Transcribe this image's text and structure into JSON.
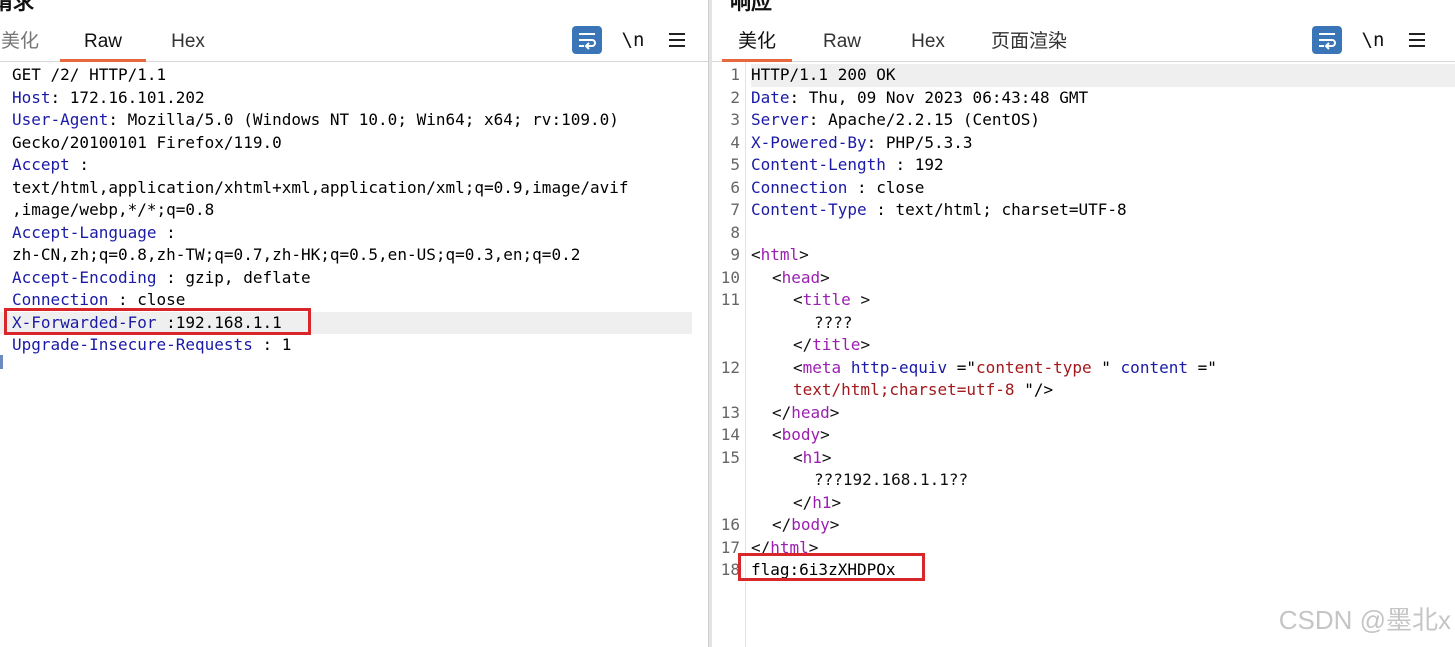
{
  "request": {
    "title": "请求",
    "tabs": [
      {
        "label": "美化",
        "active": false
      },
      {
        "label": "Raw",
        "active": true
      },
      {
        "label": "Hex",
        "active": false
      }
    ],
    "tools": {
      "newline_label": "\\n"
    },
    "lines": [
      {
        "plain": "GET /2/ HTTP/1.1"
      },
      {
        "key": "Host",
        "sep": ": ",
        "value": "172.16.101.202"
      },
      {
        "key": "User-Agent",
        "sep": ": ",
        "value": "Mozilla/5.0 (Windows NT 10.0; Win64; x64; rv:109.0)"
      },
      {
        "plain": "Gecko/20100101 Firefox/119.0"
      },
      {
        "key": "Accept",
        "sep": " :",
        "value": ""
      },
      {
        "plain": "text/html,application/xhtml+xml,application/xml;q=0.9,image/avif"
      },
      {
        "plain": ",image/webp,*/*;q=0.8"
      },
      {
        "key": "Accept-Language",
        "sep": " :",
        "value": ""
      },
      {
        "plain": "zh-CN,zh;q=0.8,zh-TW;q=0.7,zh-HK;q=0.5,en-US;q=0.3,en;q=0.2"
      },
      {
        "key": "Accept-Encoding",
        "sep": " : ",
        "value": "gzip, deflate"
      },
      {
        "key": "Connection",
        "sep": " : ",
        "value": "close"
      },
      {
        "key": "X-Forwarded-For",
        "sep": " :",
        "value": "192.168.1.1",
        "highlight": true
      },
      {
        "key": "Upgrade-Insecure-Requests",
        "sep": " : ",
        "value": "1"
      }
    ]
  },
  "response": {
    "title": "响应",
    "tabs": [
      {
        "label": "美化",
        "active": true
      },
      {
        "label": "Raw",
        "active": false
      },
      {
        "label": "Hex",
        "active": false
      },
      {
        "label": "页面渲染",
        "active": false
      }
    ],
    "tools": {
      "newline_label": "\\n"
    },
    "line_numbers": [
      "1",
      "2",
      "3",
      "4",
      "5",
      "6",
      "7",
      "8",
      "9",
      "10",
      "11",
      "",
      "",
      "12",
      "",
      "13",
      "14",
      "15",
      "",
      "",
      "16",
      "17",
      "18"
    ],
    "header_lines": {
      "status": "HTTP/1.1 200 OK",
      "date_key": "Date",
      "date_val": ": Thu, 09 Nov 2023 06:43:48 GMT",
      "server_key": "Server",
      "server_val": ": Apache/2.2.15 (CentOS)",
      "powered_key": "X-Powered-By",
      "powered_val": ": PHP/5.3.3",
      "length_key": "Content-Length",
      "length_val": " : 192",
      "conn_key": "Connection",
      "conn_val": " : close",
      "type_key": "Content-Type",
      "type_val": " : text/html; charset=UTF-8"
    },
    "html": {
      "html_tag": "html",
      "head_tag": "head",
      "title_tag": "title",
      "title_text": "????",
      "meta_tag": "meta",
      "meta_attr1": "http-equiv",
      "meta_eq1": " =\"",
      "meta_val1": "content-type",
      "meta_q1": " \" ",
      "meta_attr2": "content",
      "meta_eq2": " =\"",
      "meta_val2": "text/html;charset=utf-8",
      "meta_end": " \"/>",
      "body_tag": "body",
      "h1_tag": "h1",
      "h1_text": "???192.168.1.1??"
    },
    "flag": "flag:6i3zXHDPOx"
  },
  "watermark": "CSDN @墨北x"
}
